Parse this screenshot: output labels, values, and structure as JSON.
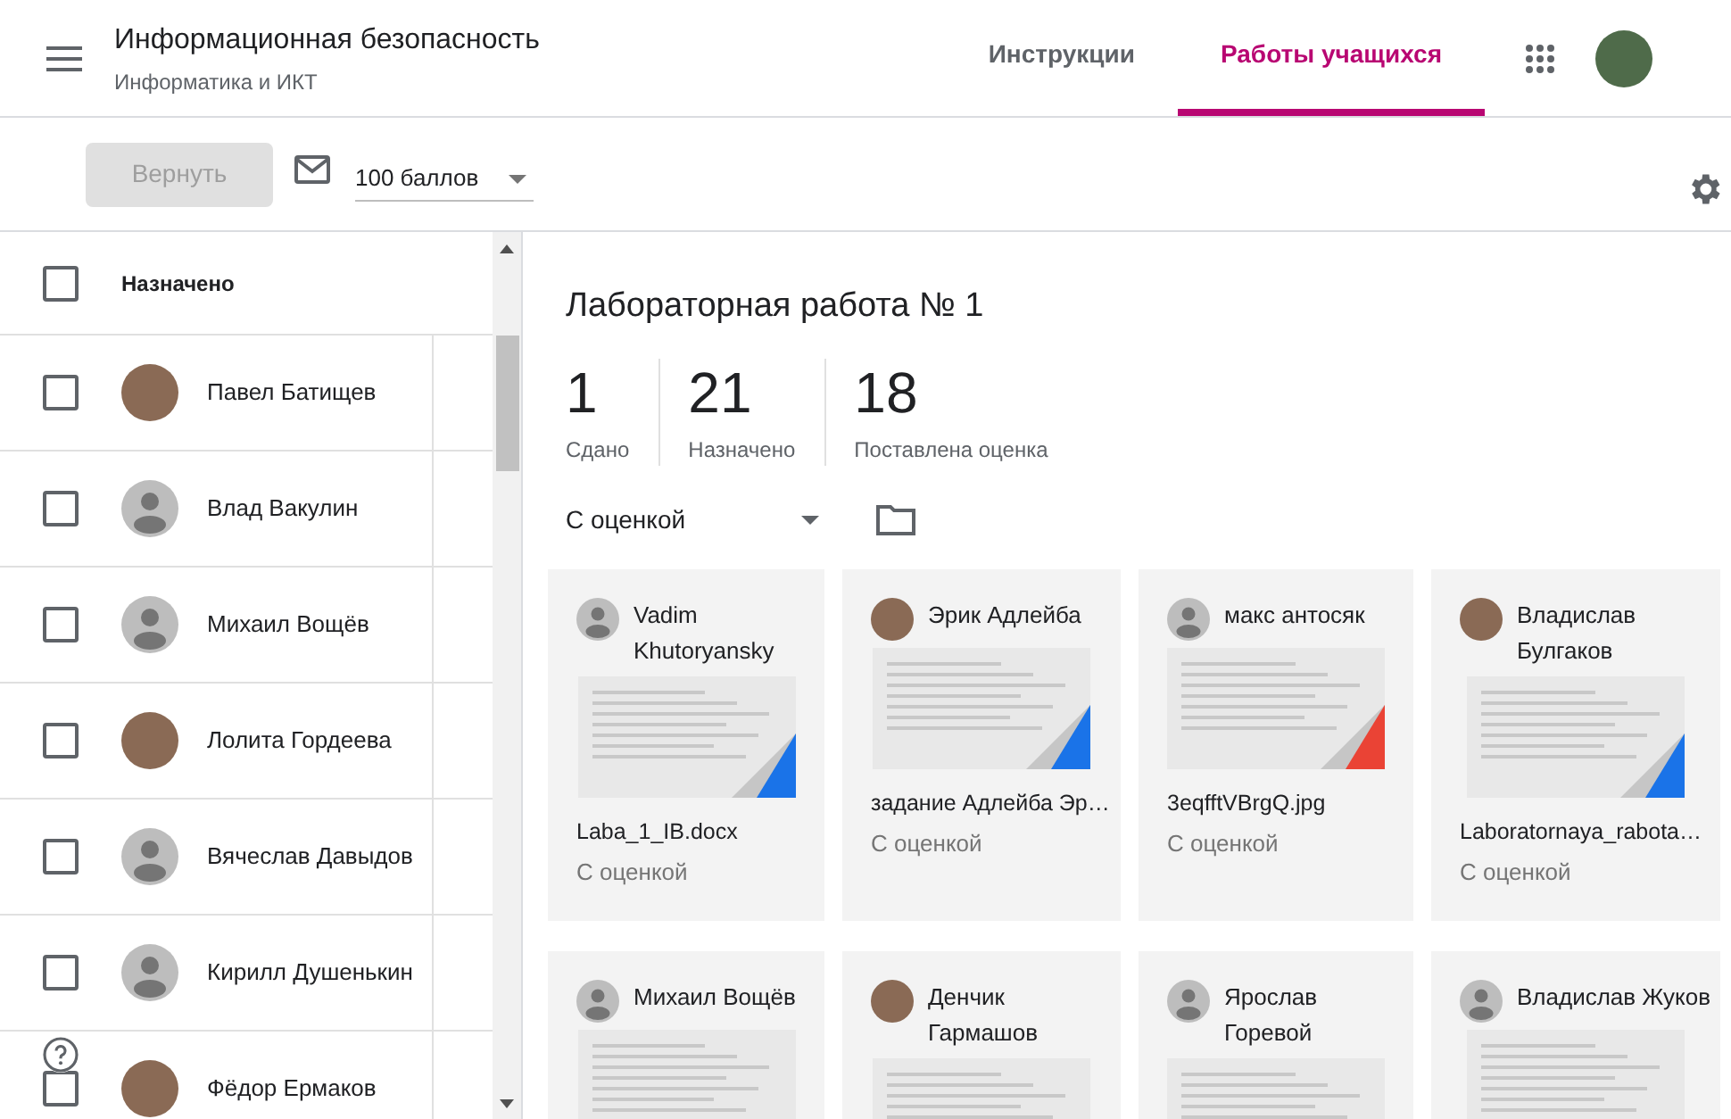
{
  "header": {
    "title": "Информационная безопасность",
    "subtitle": "Информатика и ИКТ",
    "tabs": [
      {
        "label": "Инструкции",
        "selected": false
      },
      {
        "label": "Работы учащихся",
        "selected": true
      }
    ]
  },
  "toolbar": {
    "return_button": {
      "label": "Вернуть",
      "disabled": true
    },
    "points": {
      "value": "100 баллов"
    }
  },
  "student_list": {
    "header": {
      "label": "Назначено",
      "checked": false
    },
    "students": [
      {
        "name": "Павел Батищев",
        "avatar": {
          "kind": "photo"
        },
        "checked": false
      },
      {
        "name": "Влад Вакулин",
        "avatar": {
          "kind": "default"
        },
        "checked": false
      },
      {
        "name": "Михаил Вощёв",
        "avatar": {
          "kind": "default"
        },
        "checked": false
      },
      {
        "name": "Лолита Гордеева",
        "avatar": {
          "kind": "photo"
        },
        "checked": false
      },
      {
        "name": "Вячеслав Давыдов",
        "avatar": {
          "kind": "default"
        },
        "checked": false
      },
      {
        "name": "Кирилл Душенькин",
        "avatar": {
          "kind": "default"
        },
        "checked": false
      },
      {
        "name": "Фёдор Ермаков",
        "avatar": {
          "kind": "photo"
        },
        "checked": false
      }
    ]
  },
  "assignment": {
    "title": "Лабораторная работа № 1",
    "stats": [
      {
        "value": "1",
        "label": "Сдано"
      },
      {
        "value": "21",
        "label": "Назначено"
      },
      {
        "value": "18",
        "label": "Поставлена оценка"
      }
    ],
    "filter": {
      "value": "С оценкой"
    },
    "cards": [
      {
        "student": "Vadim Khutoryansky",
        "avatar": {
          "kind": "default"
        },
        "file": "Laba_1_IB.docx",
        "color": "#1a73e8",
        "status": "С оценкой"
      },
      {
        "student": "Эрик Адлейба",
        "avatar": {
          "kind": "photo"
        },
        "file": "задание Адлейба Эр…",
        "color": "#1a73e8",
        "status": "С оценкой"
      },
      {
        "student": "макс антосяк",
        "avatar": {
          "kind": "default"
        },
        "file": "3eqfftVBrgQ.jpg",
        "color": "#ea4335",
        "status": "С оценкой"
      },
      {
        "student": "Владислав Булгаков",
        "avatar": {
          "kind": "photo"
        },
        "file": "Laboratornaya_rabota…",
        "color": "#1a73e8",
        "status": "С оценкой"
      },
      {
        "student": "Михаил Вощёв",
        "avatar": {
          "kind": "default"
        }
      },
      {
        "student": "Денчик Гармашов",
        "avatar": {
          "kind": "photo"
        }
      },
      {
        "student": "Ярослав Горевой",
        "avatar": {
          "kind": "default"
        }
      },
      {
        "student": "Владислав Жуков",
        "avatar": {
          "kind": "default"
        }
      }
    ]
  }
}
